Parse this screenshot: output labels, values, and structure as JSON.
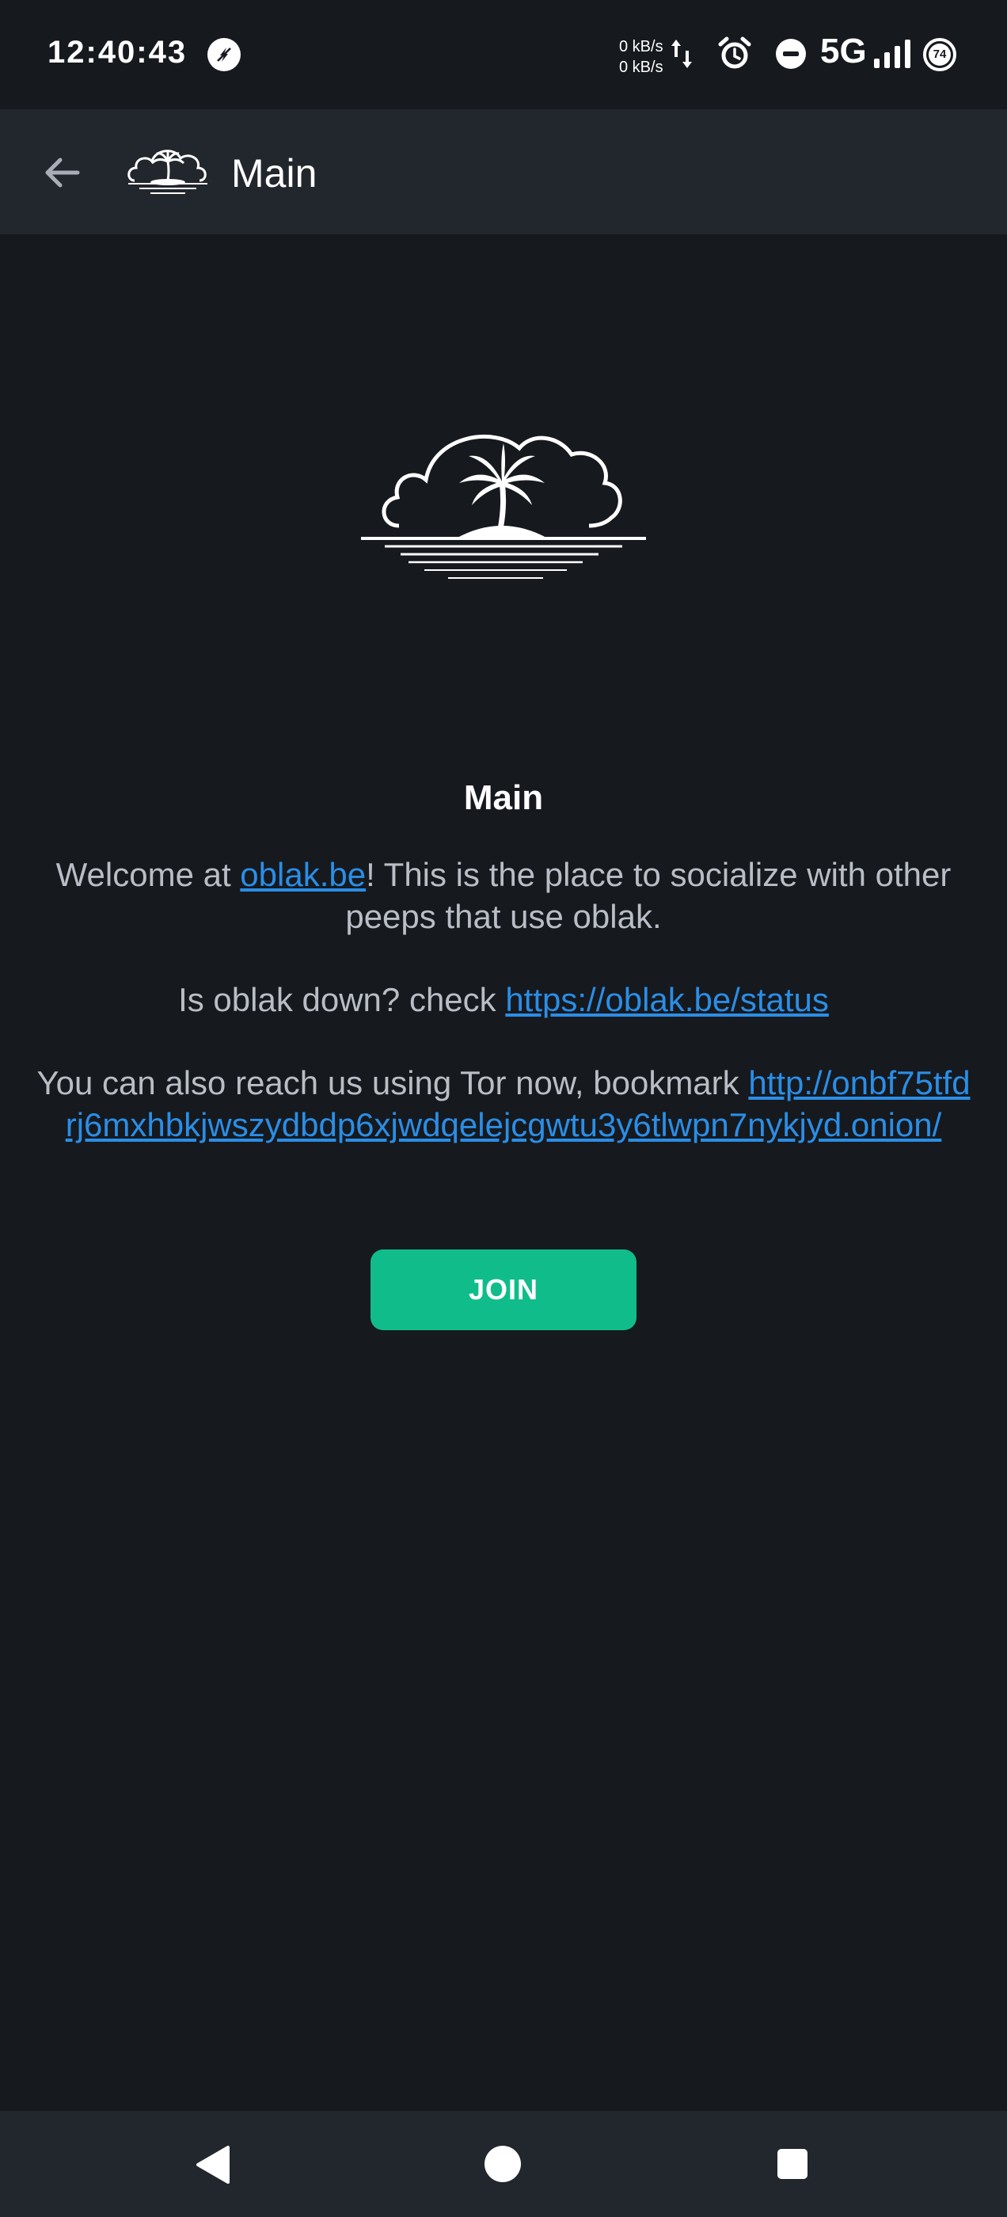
{
  "status_bar": {
    "time": "12:40:43",
    "net_up": "0 kB/s",
    "net_down": "0 kB/s",
    "network": "5G",
    "battery": "74"
  },
  "app_bar": {
    "title": "Main"
  },
  "main": {
    "heading": "Main",
    "welcome_prefix": "Welcome at ",
    "welcome_link": "oblak.be",
    "welcome_suffix": "! This is the place to socialize with other peeps that use oblak.",
    "status_prefix": "Is oblak down? check ",
    "status_link": "https://oblak.be/status",
    "tor_prefix": "You can also reach us using Tor now, bookmark ",
    "tor_link": "http://onbf75tfdrj6mxhbkjwszydbdp6xjwdqelejcgwtu3y6tlwpn7nykjyd.onion/",
    "join_label": "JOIN"
  },
  "colors": {
    "background": "#16191e",
    "app_bar": "#22262d",
    "link": "#2a8ee6",
    "button": "#10bd8a",
    "body_text": "#b9bec6"
  },
  "icons": {
    "status_left": "no-signal-circle-icon",
    "back": "arrow-left-icon",
    "logo": "palm-island-cloud-logo",
    "nav": [
      "triangle-back-icon",
      "circle-home-icon",
      "square-recents-icon"
    ]
  }
}
